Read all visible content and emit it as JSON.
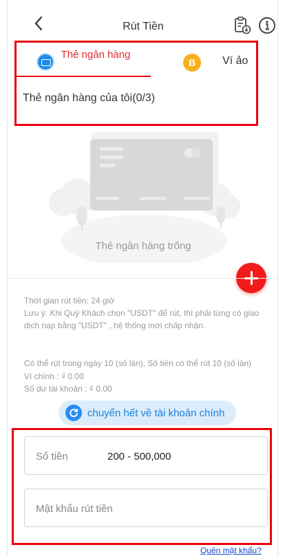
{
  "header": {
    "title": "Rút Tiền",
    "back_icon": "chevron-left-icon",
    "records_icon": "clipboard-download-icon",
    "info_icon": "info-circle-icon"
  },
  "tabs": [
    {
      "label": "Thẻ ngân hàng",
      "icon": "bank-card-icon",
      "active": true
    },
    {
      "label": "Ví ảo",
      "icon": "bitcoin-coin-icon",
      "coin_letter": "B",
      "active": false
    }
  ],
  "cards": {
    "title": "Thẻ ngân hàng của tôi(0/3)",
    "empty_text": "Thẻ ngân hàng trống"
  },
  "notes": {
    "time": "Thời gian rút tiền:  24 giờ",
    "warning": "Lưu ý:  Khi Quý Khách chọn \"USDT\" để rút, thì phải từng có giao dịch nạp bằng \"USDT\" , hệ thống mới chấp nhận.",
    "limit": "Có thể rút trong ngày 10 (số lần), Số tiền có thể rút 10 (số lần)",
    "main_wallet": "Ví chính : ₫ 0.00",
    "account_balance": "Số dư tài khoản : ₫ 0.00"
  },
  "transfer_button": "chuyển hết về tài khoản chính",
  "form": {
    "amount_label": "Số tiền",
    "amount_range": "200 - 500,000",
    "password_placeholder": "Mật khẩu rút tiền",
    "forgot_link": "Quên mật khẩu?"
  },
  "colors": {
    "accent_red": "#f11b1b",
    "highlight_box": "#e8000b",
    "link_blue": "#1546c8",
    "button_blue_bg": "#dbedfb",
    "coin_gold": "#f6b01a"
  }
}
